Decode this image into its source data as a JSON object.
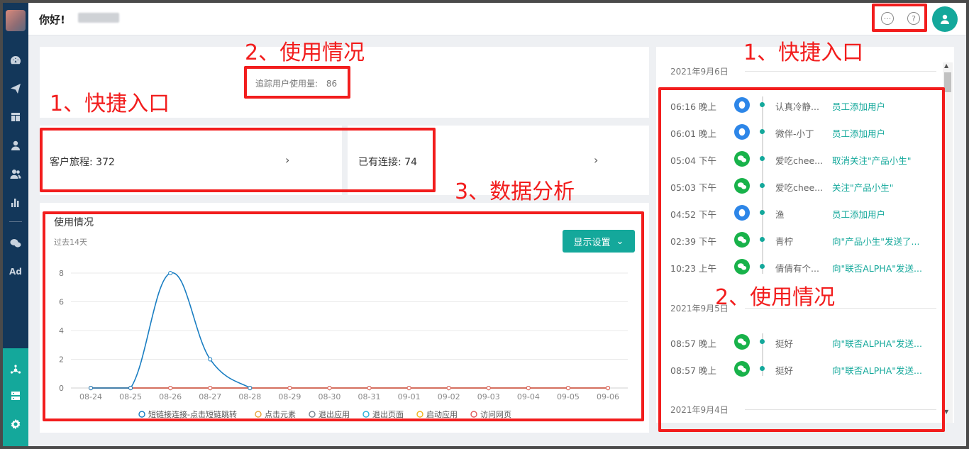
{
  "header": {
    "greeting": "你好!"
  },
  "usage_box": {
    "label": "追踪用户使用量:",
    "value": "86"
  },
  "entries": [
    {
      "label": "客户旅程: 372"
    },
    {
      "label": "已有连接: 74"
    }
  ],
  "chart_section": {
    "title": "使用情况",
    "subtitle": "过去14天",
    "display_button": "显示设置"
  },
  "chart_data": {
    "type": "line",
    "categories": [
      "08-24",
      "08-25",
      "08-26",
      "08-27",
      "08-28",
      "08-29",
      "08-30",
      "08-31",
      "09-01",
      "09-02",
      "09-03",
      "09-04",
      "09-05",
      "09-06"
    ],
    "ylim": [
      0,
      8
    ],
    "yticks": [
      0,
      2,
      4,
      6,
      8
    ],
    "grid": true,
    "legend_position": "bottom",
    "series": [
      {
        "name": "短链接连接-点击短链跳转",
        "color": "#1a7ec2",
        "values": [
          0,
          0,
          8,
          2,
          0,
          null,
          null,
          null,
          null,
          null,
          null,
          null,
          null,
          null
        ],
        "smooth": true
      },
      {
        "name": "点击元素",
        "color": "#e8a33a",
        "values": [
          0,
          0,
          0,
          0,
          0,
          0,
          0,
          0,
          0,
          0,
          0,
          0,
          0,
          0
        ]
      },
      {
        "name": "退出应用",
        "color": "#7a8591",
        "values": [
          0,
          0,
          0,
          0,
          0,
          0,
          0,
          0,
          0,
          0,
          0,
          0,
          0,
          0
        ]
      },
      {
        "name": "退出页面",
        "color": "#28b0d8",
        "values": [
          0,
          0,
          0,
          0,
          0,
          0,
          0,
          0,
          0,
          0,
          0,
          0,
          0,
          0
        ]
      },
      {
        "name": "启动应用",
        "color": "#f0b21a",
        "values": [
          0,
          0,
          0,
          0,
          0,
          0,
          0,
          0,
          0,
          0,
          0,
          0,
          0,
          0
        ]
      },
      {
        "name": "访问网页",
        "color": "#e05a5a",
        "values": [
          0,
          0,
          0,
          0,
          0,
          0,
          0,
          0,
          0,
          0,
          0,
          0,
          0,
          0
        ]
      }
    ]
  },
  "timeline": {
    "dates": [
      "2021年9月6日",
      "2021年9月5日",
      "2021年9月4日"
    ],
    "rows": [
      {
        "time": "06:16 晚上",
        "channel": "qq-icon",
        "name": "认真冷静...",
        "action": "员工添加用户"
      },
      {
        "time": "06:01 晚上",
        "channel": "qq-icon",
        "name": "微伴-小丁",
        "action": "员工添加用户"
      },
      {
        "time": "05:04 下午",
        "channel": "wechat-icon",
        "name": "爱吃chee...",
        "action": "取消关注\"产品小生\""
      },
      {
        "time": "05:03 下午",
        "channel": "wechat-icon",
        "name": "爱吃chee...",
        "action": "关注\"产品小生\""
      },
      {
        "time": "04:52 下午",
        "channel": "qq-icon",
        "name": "渔",
        "action": "员工添加用户"
      },
      {
        "time": "02:39 下午",
        "channel": "wechat-icon",
        "name": "青柠",
        "action": "向\"产品小生\"发送了..."
      },
      {
        "time": "10:23 上午",
        "channel": "wechat-icon",
        "name": "倩倩有个...",
        "action": "向\"联否ALPHA\"发送..."
      },
      {
        "time": "08:57 晚上",
        "channel": "wechat-icon",
        "name": "挺好",
        "action": "向\"联否ALPHA\"发送..."
      },
      {
        "time": "08:57 晚上",
        "channel": "wechat-icon",
        "name": "挺好",
        "action": "向\"联否ALPHA\"发送..."
      }
    ]
  },
  "annotations": {
    "a1": "2、使用情况",
    "a2": "1、快捷入口",
    "a3": "3、数据分析",
    "a4": "1、快捷入口",
    "a5": "2、使用情况"
  },
  "colors": {
    "accent": "#14a89b",
    "sidebar": "#13375a",
    "annotation": "#f21d1d"
  }
}
